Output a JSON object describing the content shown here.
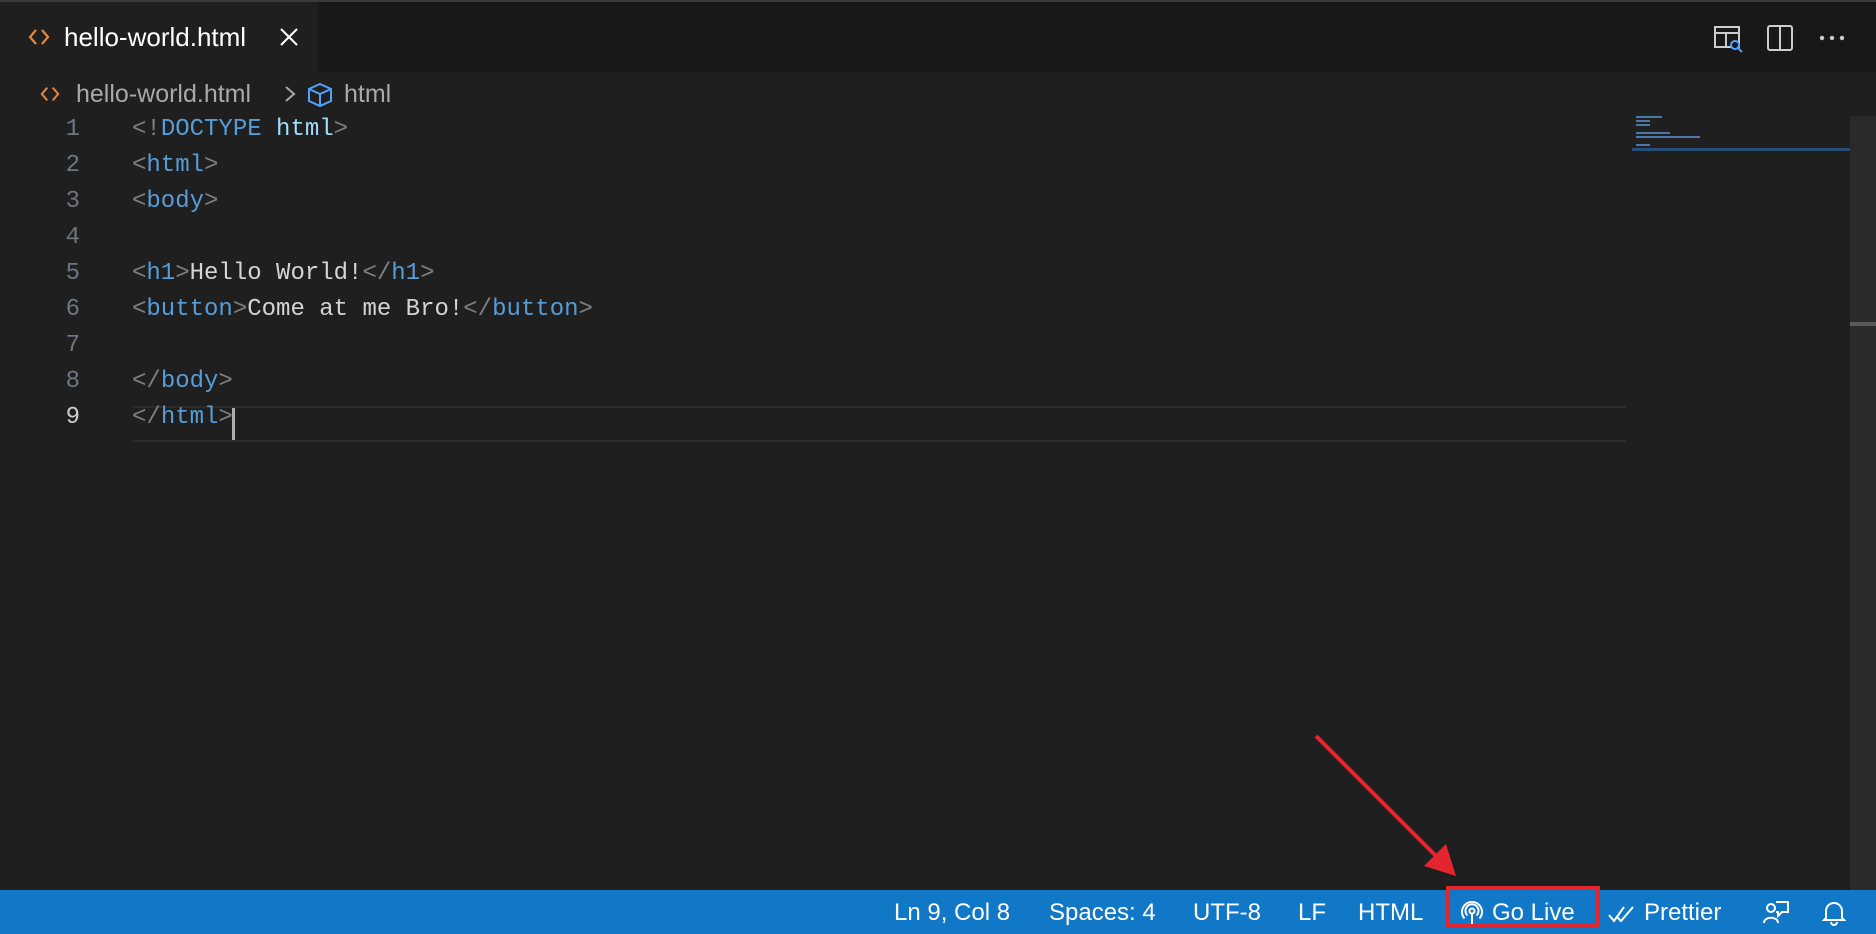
{
  "tab": {
    "title": "hello-world.html",
    "file_icon": "code-brackets-icon",
    "close_icon": "close-icon"
  },
  "editor_actions": [
    "open-preview-icon",
    "split-editor-icon",
    "more-actions-icon"
  ],
  "breadcrumb": {
    "file": "hello-world.html",
    "symbol": "html",
    "separator_icon": "chevron-right-icon",
    "symbol_icon": "cube-icon"
  },
  "code": {
    "line_numbers": [
      "1",
      "2",
      "3",
      "4",
      "5",
      "6",
      "7",
      "8",
      "9"
    ],
    "active_line": "9",
    "lines": [
      [
        {
          "t": "<!",
          "c": "punct"
        },
        {
          "t": "DOCTYPE",
          "c": "tag"
        },
        {
          "t": " html",
          "c": "attr"
        },
        {
          "t": ">",
          "c": "punct"
        }
      ],
      [
        {
          "t": "<",
          "c": "punct"
        },
        {
          "t": "html",
          "c": "tag"
        },
        {
          "t": ">",
          "c": "punct"
        }
      ],
      [
        {
          "t": "<",
          "c": "punct"
        },
        {
          "t": "body",
          "c": "tag"
        },
        {
          "t": ">",
          "c": "punct"
        }
      ],
      [],
      [
        {
          "t": "<",
          "c": "punct"
        },
        {
          "t": "h1",
          "c": "tag"
        },
        {
          "t": ">",
          "c": "punct"
        },
        {
          "t": "Hello World!",
          "c": "text"
        },
        {
          "t": "</",
          "c": "punct"
        },
        {
          "t": "h1",
          "c": "tag"
        },
        {
          "t": ">",
          "c": "punct"
        }
      ],
      [
        {
          "t": "<",
          "c": "punct"
        },
        {
          "t": "button",
          "c": "tag"
        },
        {
          "t": ">",
          "c": "punct"
        },
        {
          "t": "Come at me Bro!",
          "c": "text"
        },
        {
          "t": "</",
          "c": "punct"
        },
        {
          "t": "button",
          "c": "tag"
        },
        {
          "t": ">",
          "c": "punct"
        }
      ],
      [],
      [
        {
          "t": "</",
          "c": "punct"
        },
        {
          "t": "body",
          "c": "tag"
        },
        {
          "t": ">",
          "c": "punct"
        }
      ],
      [
        {
          "t": "</",
          "c": "punct"
        },
        {
          "t": "html",
          "c": "tag"
        },
        {
          "t": ">",
          "c": "punct"
        }
      ]
    ]
  },
  "status_bar": {
    "position": "Ln 9, Col 8",
    "spaces": "Spaces: 4",
    "encoding": "UTF-8",
    "eol": "LF",
    "language": "HTML",
    "go_live": "Go Live",
    "go_live_icon": "broadcast-icon",
    "prettier": "Prettier",
    "prettier_icon": "double-check-icon",
    "feedback_icon": "feedback-icon",
    "notifications_icon": "bell-icon"
  },
  "colors": {
    "status_bar": "#1177c7",
    "highlight_box": "#e3262e",
    "tag": "#569cd6",
    "attr": "#9cdcfe",
    "punct": "#808080",
    "file_icon": "#e8883a"
  }
}
